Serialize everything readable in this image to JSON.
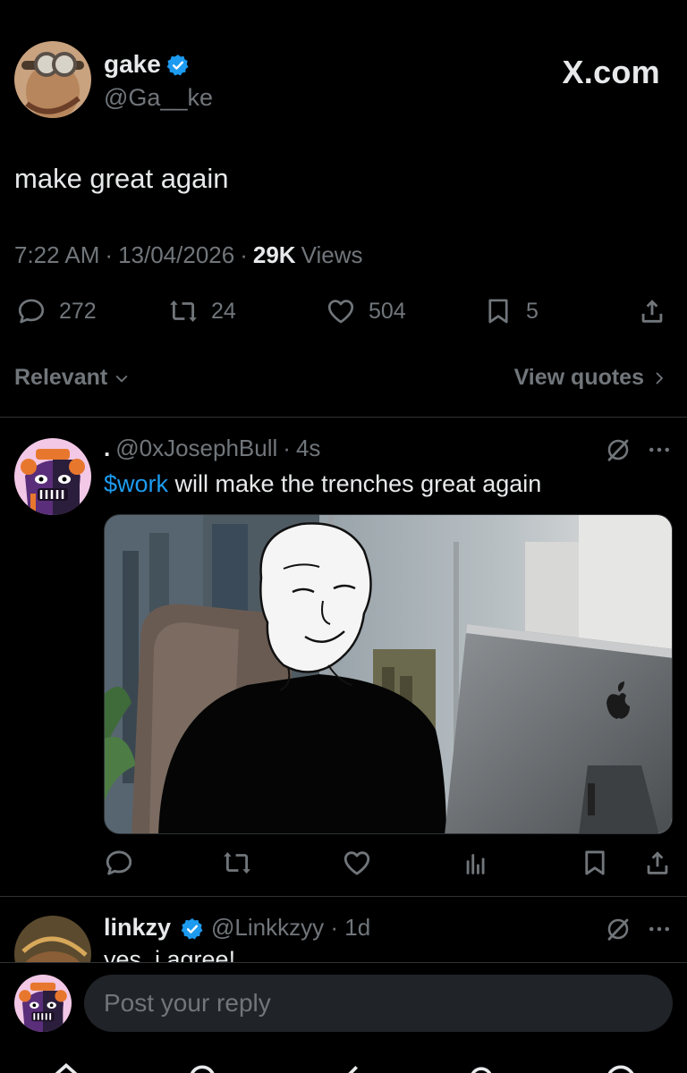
{
  "post": {
    "author_name": "gake",
    "author_handle": "@Ga__ke",
    "brand": "X.com",
    "text": "make great again",
    "time": "7:22 AM",
    "date": "13/04/2026",
    "views_count": "29K",
    "views_label": "Views",
    "replies": "272",
    "reposts": "24",
    "likes": "504",
    "bookmarks": "5"
  },
  "sort": {
    "label": "Relevant",
    "quotes_label": "View quotes"
  },
  "replies": [
    {
      "prefix": ".",
      "handle": "@0xJosephBull",
      "time": "4s",
      "cashtag": "$work",
      "text": " will make the trenches great again",
      "media_icon": "apple-logo-icon"
    },
    {
      "name": "linkzy",
      "handle": "@Linkkzyy",
      "time": "1d",
      "text": "yes, i agree!"
    }
  ],
  "composer": {
    "placeholder": "Post your reply"
  },
  "icons": {
    "reply": "speech-bubble-icon",
    "repost": "repost-icon",
    "like": "heart-icon",
    "bookmark": "bookmark-icon",
    "share": "share-icon",
    "views": "bar-chart-icon",
    "grok": "grok-icon",
    "more": "more-icon"
  },
  "colors": {
    "background": "#000000",
    "text": "#e7e9ea",
    "muted": "#71767b",
    "accent": "#1d9bf0",
    "divider": "#2f3336"
  }
}
